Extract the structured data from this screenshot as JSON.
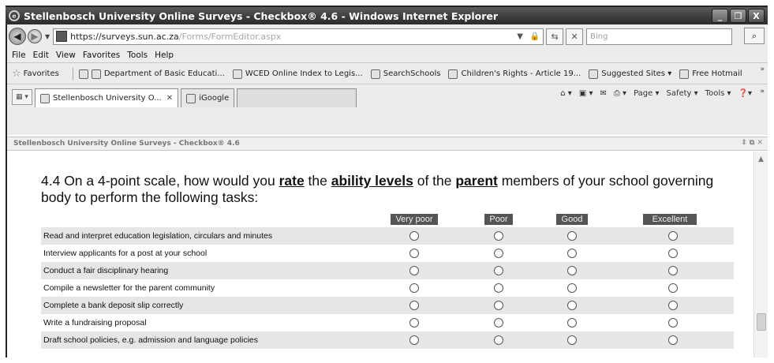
{
  "window": {
    "title": "Stellenbosch University Online Surveys - Checkbox® 4.6 - Windows Internet Explorer",
    "controls": [
      "_",
      "❐",
      "X"
    ]
  },
  "address_bar": {
    "url_host": "https://surveys.sun.ac.za",
    "url_path": "/Forms/FormEditor.aspx",
    "search_placeholder": "Bing"
  },
  "menu": {
    "items": [
      "File",
      "Edit",
      "View",
      "Favorites",
      "Tools",
      "Help"
    ]
  },
  "favorites_bar": {
    "label": "Favorites",
    "items": [
      "Department of Basic Educati...",
      "WCED Online Index to Legis...",
      "SearchSchools",
      "Children's Rights - Article 19...",
      "Suggested Sites ▾",
      "Free Hotmail"
    ]
  },
  "tabs": {
    "items": [
      {
        "label": "Stellenbosch University O...",
        "active": true
      },
      {
        "label": "iGoogle",
        "active": false
      }
    ],
    "close_glyph": "✕"
  },
  "command_bar": {
    "items": [
      "Page ▾",
      "Safety ▾",
      "Tools ▾"
    ]
  },
  "page": {
    "header": "Stellenbosch University Online Surveys - Checkbox® 4.6"
  },
  "survey": {
    "question_prefix": "4.4 On a 4-point scale, how would you ",
    "emph1": "rate",
    "q_mid1": " the ",
    "emph2": "ability levels",
    "q_mid2": " of the ",
    "emph3": "parent",
    "question_suffix": " members of your school governing body to perform the following tasks:",
    "scale": [
      "Very poor",
      "Poor",
      "Good",
      "Excellent"
    ],
    "items": [
      "Read and interpret education legislation, circulars and minutes",
      "Interview applicants for a post at your school",
      "Conduct a fair disciplinary hearing",
      "Compile a newsletter for the parent community",
      "Complete a bank deposit slip correctly",
      "Write a fundraising proposal",
      "Draft school policies, e.g. admission and language policies"
    ]
  }
}
